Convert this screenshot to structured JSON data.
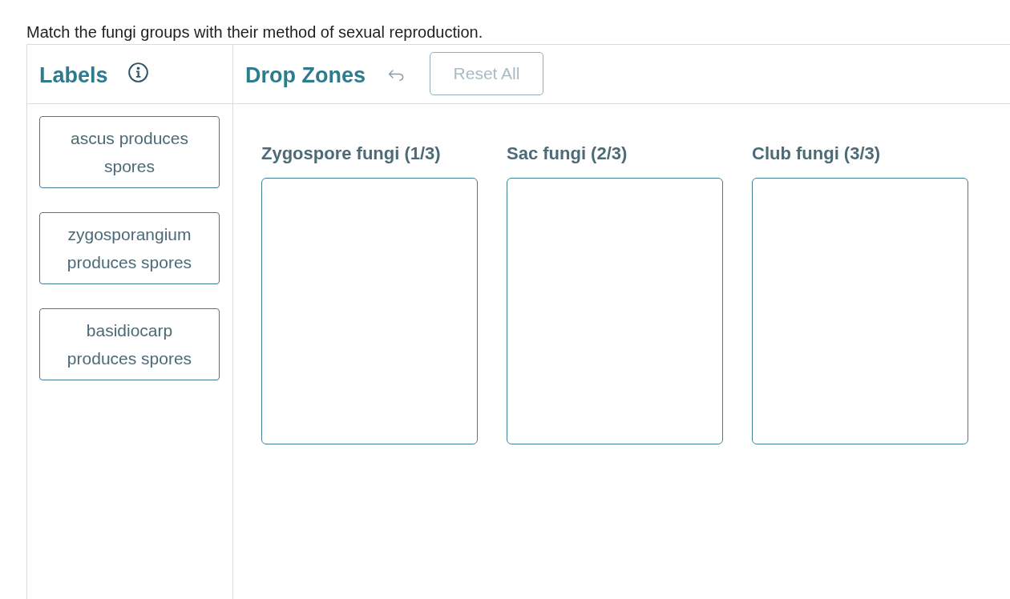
{
  "instruction": "Match the fungi groups with their method of sexual reproduction.",
  "labels_panel": {
    "title": "Labels",
    "labels": [
      "ascus produces spores",
      "zygosporangium produces spores",
      "basidiocarp produces spores"
    ]
  },
  "drop_panel": {
    "title": "Drop Zones",
    "reset_button": {
      "label": "Reset All",
      "disabled": true
    },
    "zones": [
      {
        "heading": "Zygospore fungi (1/3)"
      },
      {
        "heading": "Sac fungi (2/3)"
      },
      {
        "heading": "Club fungi (3/3)"
      }
    ]
  }
}
